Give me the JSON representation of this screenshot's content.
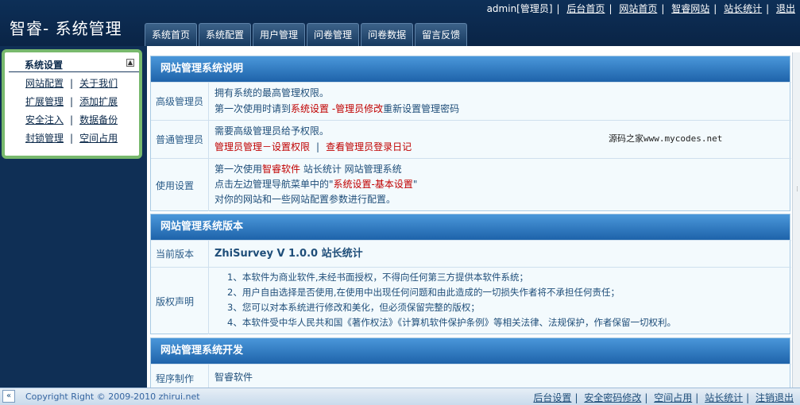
{
  "header": {
    "brand": "智睿- 系统管理",
    "user": "admin[管理员]",
    "links": [
      "后台首页",
      "网站首页",
      "智睿网站",
      "站长统计",
      "退出"
    ]
  },
  "nav": {
    "tabs": [
      "系统首页",
      "系统配置",
      "用户管理",
      "问卷管理",
      "问卷数据",
      "留言反馈"
    ]
  },
  "sidebar": {
    "title": "系统设置",
    "toggle": "▲",
    "rows": [
      [
        "网站配置",
        "关于我们"
      ],
      [
        "扩展管理",
        "添加扩展"
      ],
      [
        "安全注入",
        "数据备份"
      ],
      [
        "封锁管理",
        "空间占用"
      ]
    ]
  },
  "panels": {
    "intro": {
      "title": "网站管理系统说明",
      "admin_label": "高级管理员",
      "admin_line1": "拥有系统的最高管理权限。",
      "admin_line2_a": "第一次使用时请到",
      "admin_line2_red": "系统设置 -管理员修改",
      "admin_line2_b": "重新设置管理密码",
      "normal_label": "普通管理员",
      "normal_line1": "需要高级管理员给予权限。",
      "normal_link1": "管理员管理－设置权限",
      "normal_sep": "|",
      "normal_link2": "查看管理员登录日记",
      "usage_label": "使用设置",
      "usage_line1_a": "第一次使用",
      "usage_line1_red": "智睿软件",
      "usage_line1_b": " 站长统计 网站管理系统",
      "usage_line2_a": "点击左边管理导航菜单中的\"",
      "usage_line2_red": "系统设置-基本设置",
      "usage_line2_b": "\"",
      "usage_line3": "对你的网站和一些网站配置参数进行配置。"
    },
    "version": {
      "title": "网站管理系统版本",
      "current_label": "当前版本",
      "current_value": "ZhiSurvey V 1.0.0 站长统计",
      "copyright_label": "版权声明",
      "items": [
        "1、本软件为商业软件,未经书面授权，不得向任何第三方提供本软件系统；",
        "2、用户自由选择是否使用,在使用中出现任何问题和由此造成的一切损失作者将不承担任何责任；",
        "3、您可以对本系统进行修改和美化，但必须保留完整的版权；",
        "4、本软件受中华人民共和国《著作权法》《计算机软件保护条例》等相关法律、法规保护，作者保留一切权利。"
      ]
    },
    "dev": {
      "title": "网站管理系统开发",
      "maker_label": "程序制作",
      "maker_value": "智睿软件"
    }
  },
  "watermark": "源码之家www.mycodes.net",
  "footer": {
    "collapse": "«",
    "copyright": "Copyright Right © 2009-2010 zhirui.net",
    "links": [
      "后台设置",
      "安全密码修改",
      "空间占用",
      "站长统计",
      "注销退出"
    ]
  }
}
